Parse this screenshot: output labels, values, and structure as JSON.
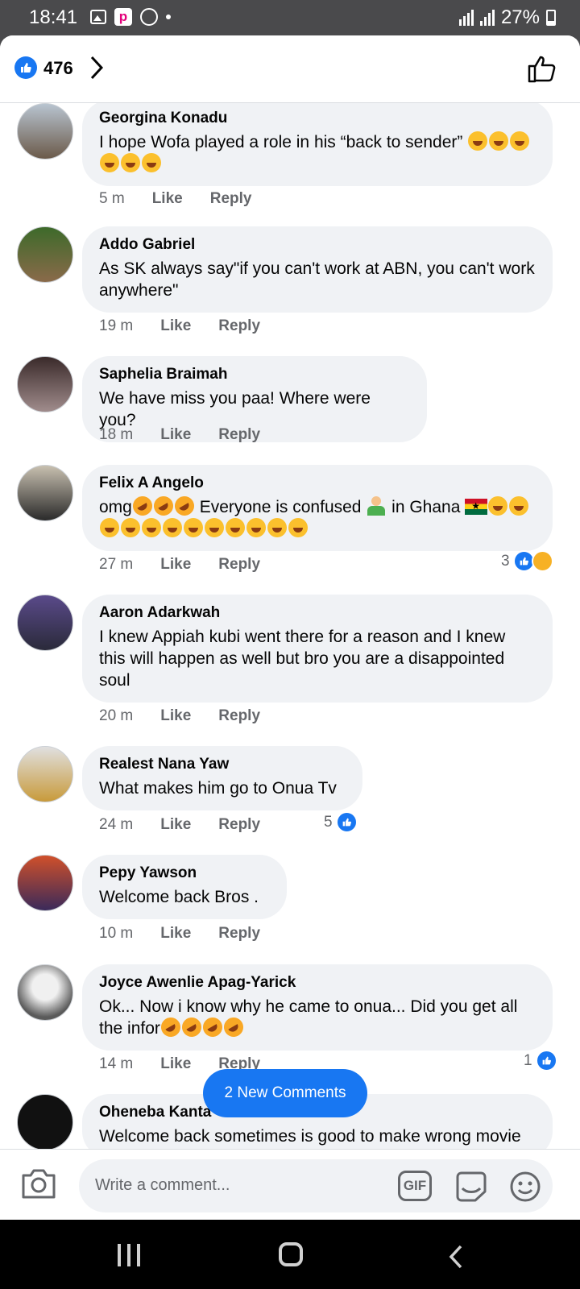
{
  "status_bar": {
    "time": "18:41",
    "battery": "27%"
  },
  "header": {
    "reaction_count": "476"
  },
  "comments": [
    {
      "name": "Georgina Konadu",
      "text_html": "I hope Wofa played a role in his “back to sender” <span class=\"emoji-laugh\"></span><span class=\"emoji-laugh\"></span><span class=\"emoji-laugh\"></span><br><span class=\"emoji-laugh\"></span><span class=\"emoji-laugh\"></span><span class=\"emoji-laugh\"></span>",
      "time": "5 m",
      "like": "Like",
      "reply": "Reply",
      "reactions": ""
    },
    {
      "name": "Addo Gabriel",
      "text": "As SK always say\"if you can't work at ABN, you can't work anywhere\"",
      "time": "19 m",
      "like": "Like",
      "reply": "Reply",
      "reactions": ""
    },
    {
      "name": "Saphelia Braimah",
      "text": "We have miss you paa! Where were you?",
      "time": "18 m",
      "like": "Like",
      "reply": "Reply",
      "reactions": ""
    },
    {
      "name": "Felix A Angelo",
      "text_html": "omg<span class=\"emoji-rofl\"></span><span class=\"emoji-rofl\"></span><span class=\"emoji-rofl\"></span> Everyone is confused <span class=\"emoji-shrug\"></span> in Ghana <span class=\"flag-gh\"></span><span class=\"emoji-laugh\"></span><span class=\"emoji-laugh\"></span><br><span class=\"emoji-laugh\"></span><span class=\"emoji-laugh\"></span><span class=\"emoji-laugh\"></span><span class=\"emoji-laugh\"></span><span class=\"emoji-laugh\"></span><span class=\"emoji-laugh\"></span><span class=\"emoji-laugh\"></span><span class=\"emoji-laugh\"></span><span class=\"emoji-laugh\"></span><span class=\"emoji-laugh\"></span>",
      "time": "27 m",
      "like": "Like",
      "reply": "Reply",
      "reactions": "3"
    },
    {
      "name": "Aaron Adarkwah",
      "text": "I knew Appiah kubi went there for a reason  and I knew this will happen as well but bro you are a disappointed soul",
      "time": "20 m",
      "like": "Like",
      "reply": "Reply",
      "reactions": ""
    },
    {
      "name": "Realest Nana Yaw",
      "text": "What makes him go to Onua Tv",
      "time": "24 m",
      "like": "Like",
      "reply": "Reply",
      "reactions": "5"
    },
    {
      "name": "Pepy Yawson",
      "text": "Welcome back Bros .",
      "time": "10 m",
      "like": "Like",
      "reply": "Reply",
      "reactions": ""
    },
    {
      "name": "Joyce Awenlie Apag-Yarick",
      "text_html": "Ok... Now i know why he came to onua... Did you get all the infor<span class=\"emoji-rofl\"></span><span class=\"emoji-rofl\"></span><span class=\"emoji-rofl\"></span><span class=\"emoji-rofl\"></span>",
      "time": "14 m",
      "like": "Like",
      "reply": "Reply",
      "reactions": "1"
    },
    {
      "name": "Oheneba Kanta",
      "text": "Welcome back sometimes is good to make wrong movie",
      "time": "",
      "like": "",
      "reply": "",
      "reactions": ""
    }
  ],
  "new_comments_button": "2 New Comments",
  "composer": {
    "placeholder": "Write a comment...",
    "gif_label": "GIF"
  },
  "colors": {
    "accent": "#1877f2",
    "bubble": "#f0f2f5",
    "meta": "#65676b"
  }
}
